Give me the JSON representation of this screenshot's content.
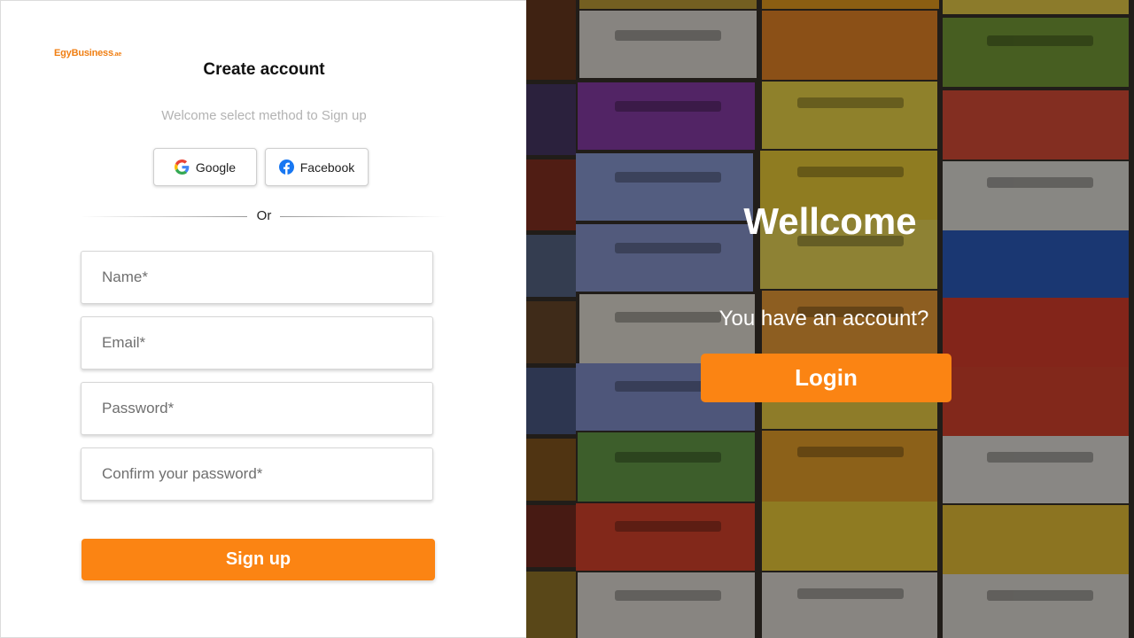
{
  "brand": {
    "logo_main": "EgyBusiness",
    "logo_suffix": ".ae"
  },
  "signup": {
    "title": "Create account",
    "subtitle": "Welcome select method to Sign up",
    "google_label": "Google",
    "facebook_label": "Facebook",
    "divider_text": "Or",
    "fields": {
      "name_placeholder": "Name*",
      "email_placeholder": "Email*",
      "password_placeholder": "Password*",
      "confirm_placeholder": "Confirm your password*"
    },
    "submit_label": "Sign up"
  },
  "side": {
    "heading": "Wellcome",
    "question": "You have an account?",
    "login_label": "Login"
  },
  "colors": {
    "accent": "#fb8413",
    "logo": "#f07f13",
    "subtitle_gray": "#b3b3b3"
  },
  "icons": [
    "google-icon",
    "facebook-icon"
  ]
}
